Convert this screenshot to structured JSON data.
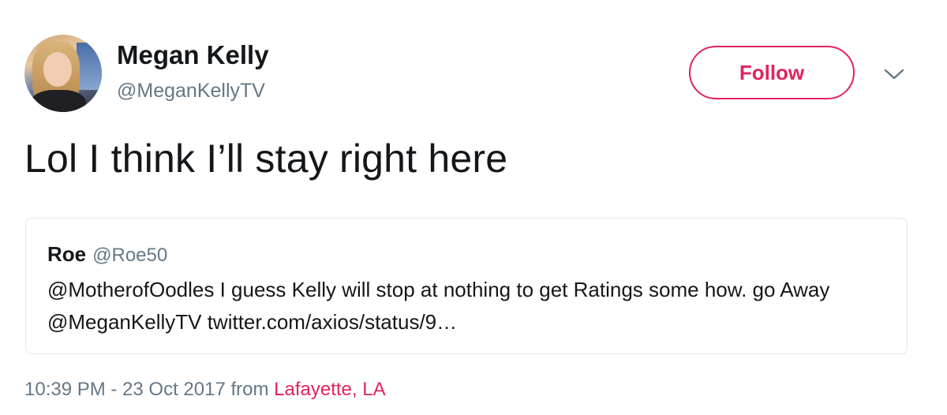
{
  "author": {
    "name": "Megan Kelly",
    "handle": "@MeganKellyTV",
    "avatar_icon": "profile-photo"
  },
  "actions": {
    "follow_label": "Follow",
    "more_icon": "chevron-down-icon"
  },
  "tweet": {
    "text": "Lol I think I’ll stay right here"
  },
  "quoted_tweet": {
    "name": "Roe",
    "handle": "@Roe50",
    "text": "@MotherofOodles I guess Kelly will stop at nothing to get Ratings some how. go Away @MeganKellyTV twitter.com/axios/status/9…"
  },
  "meta": {
    "timestamp": "10:39 PM - 23 Oct 2017",
    "from_label": "from",
    "location": "Lafayette, LA"
  },
  "colors": {
    "accent": "#e0245e",
    "secondary_text": "#657786",
    "primary_text": "#14171a",
    "border": "#e1e8ed"
  }
}
